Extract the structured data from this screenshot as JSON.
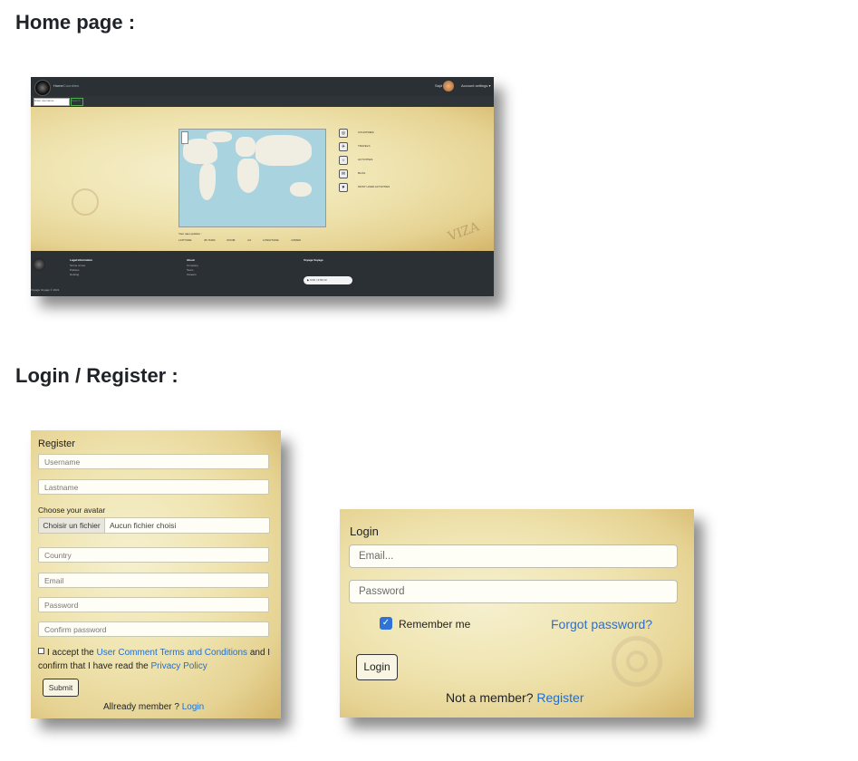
{
  "headings": {
    "home": "Home page :",
    "login_register": "Login / Register :"
  },
  "home_screenshot": {
    "nav": {
      "link1": "Home",
      "link2": "Countries",
      "user": "Sajd",
      "settings": "Account settings ▾"
    },
    "search": {
      "placeholder": "Enter username...",
      "button": "Search"
    },
    "side_menu": [
      "COUNTRIES",
      "TRAVELS",
      "ACTIVITIES",
      "BLOG",
      "MOST LIKED ACTIVITIES"
    ],
    "position_label": "Your user position :",
    "coords": "LATITUDE: 45.74460 ZOOM: 4.0 LONGITUDE: 4.84600",
    "footer": {
      "col1_head": "Legal information",
      "col1_items": [
        "Terms of use",
        "Policies",
        "Hosting"
      ],
      "col2_head": "About",
      "col2_items": [
        "Company",
        "Team",
        "Careers"
      ],
      "col3_head": "Voyage Voyage",
      "player": "0:00 / 2:54:10",
      "copyright": "Voyage Voyage © 2021"
    },
    "stamp": "VIZA"
  },
  "register": {
    "title": "Register",
    "username_placeholder": "Username",
    "lastname_placeholder": "Lastname",
    "avatar_label": "Choose your avatar",
    "file_button": "Choisir un fichier",
    "file_text": "Aucun fichier choisi",
    "country_placeholder": "Country",
    "email_placeholder": "Email",
    "password_placeholder": "Password",
    "confirm_placeholder": "Confirm password",
    "terms_prefix": "I accept the",
    "terms_link": "User Comment Terms and Conditions",
    "terms_mid": "and I confirm that I have read the",
    "privacy_link": "Privacy Policy",
    "submit": "Submit",
    "already": "Allready member ?",
    "login_link": "Login"
  },
  "login": {
    "title": "Login",
    "email_placeholder": "Email...",
    "password_placeholder": "Password",
    "remember": "Remember me",
    "forgot": "Forgot password?",
    "button": "Login",
    "not_member": "Not a member?",
    "register_link": "Register"
  }
}
